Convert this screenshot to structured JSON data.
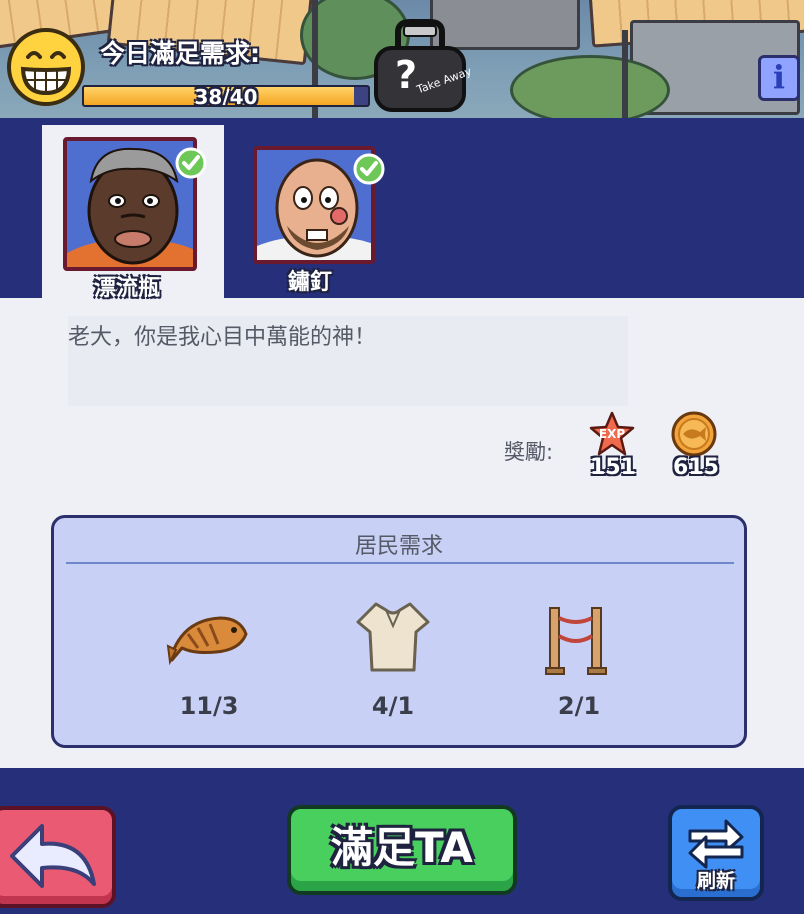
{
  "hud": {
    "title": "今日滿足需求:",
    "progress_text": "38/40",
    "progress_fraction": 0.95,
    "takeaway_icon": "takeaway-bag-icon",
    "takeaway_text": "Take Away",
    "takeaway_mark": "?",
    "info_label": "i"
  },
  "residents": [
    {
      "name": "漂流瓶",
      "selected": true,
      "satisfied": true
    },
    {
      "name": "鏽釘",
      "selected": false,
      "satisfied": true
    }
  ],
  "dialog": {
    "text": "老大，你是我心目中萬能的神！"
  },
  "reward": {
    "label": "獎勵:",
    "exp_icon": "exp-star-icon",
    "exp_badge": "EXP",
    "exp_value": "151",
    "coin_icon": "fish-coin-icon",
    "coin_value": "615"
  },
  "requirements": {
    "title": "居民需求",
    "items": [
      {
        "icon": "fish-icon",
        "count": "11/3"
      },
      {
        "icon": "shirt-icon",
        "count": "4/1"
      },
      {
        "icon": "rope-fence-icon",
        "count": "2/1"
      }
    ]
  },
  "buttons": {
    "back_icon": "back-arrow-icon",
    "confirm_label": "滿足TA",
    "refresh_label": "刷新",
    "refresh_icon": "refresh-arrows-icon"
  },
  "colors": {
    "panel_dark": "#26307a",
    "panel_light": "#eef0f6",
    "confirm_green": "#48cf5e",
    "back_red": "#ea5a72",
    "refresh_blue": "#3f8ff4",
    "progress_orange": "#f5a623"
  }
}
